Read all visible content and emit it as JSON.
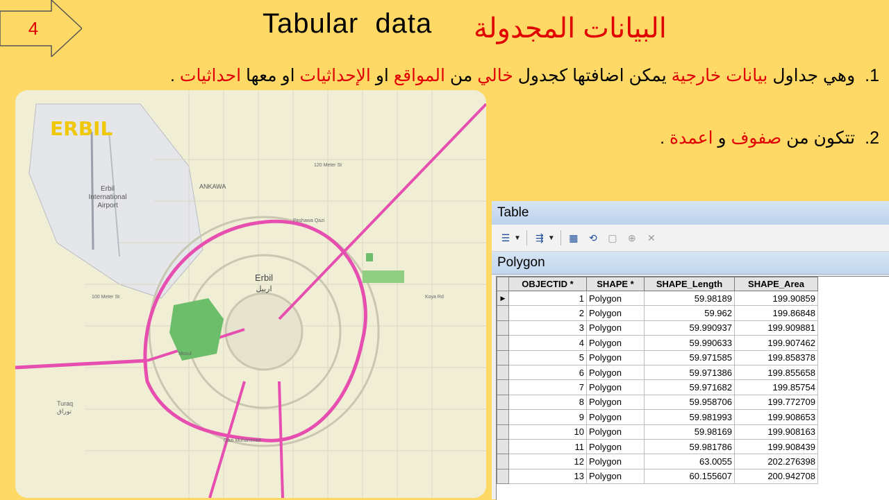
{
  "slide_number": "4",
  "title_en": "Tabular  data",
  "title_ar": "البيانات المجدولة",
  "bullets": [
    {
      "num": "1.",
      "parts": [
        {
          "t": "وهي جداول ",
          "red": false
        },
        {
          "t": "بيانات خارجية",
          "red": true
        },
        {
          "t": " يمكن اضافتها كجدول ",
          "red": false
        },
        {
          "t": "خالي",
          "red": true
        },
        {
          "t": " من ",
          "red": false
        },
        {
          "t": "المواقع",
          "red": true
        },
        {
          "t": " او ",
          "red": false
        },
        {
          "t": "الإحداثيات",
          "red": true
        },
        {
          "t": " او معها ",
          "red": false
        },
        {
          "t": "احداثيات",
          "red": true
        },
        {
          "t": " .",
          "red": false
        }
      ]
    },
    {
      "num": "2.",
      "parts": [
        {
          "t": "تتكون من ",
          "red": false
        },
        {
          "t": "صفوف",
          "red": true
        },
        {
          "t": " و ",
          "red": false
        },
        {
          "t": "اعمدة",
          "red": true
        },
        {
          "t": " .",
          "red": false
        }
      ]
    }
  ],
  "map": {
    "logo": "ERBIL",
    "city_en": "Erbil",
    "city_ar": "اربيل",
    "airport": [
      "Erbil",
      "International",
      "Airport"
    ],
    "district_ankawa": "ANKAWA",
    "turaq_en": "Turaq",
    "turaq_ar": "توراق",
    "road_labels": [
      "Peshawa Qazi",
      "120 Meter St",
      "Koya Rd",
      "Mosul",
      "Qazi Muhammad",
      "100 Meter St"
    ]
  },
  "table": {
    "window_title": "Table",
    "layer_name": "Polygon",
    "columns": [
      "OBJECTID *",
      "SHAPE *",
      "SHAPE_Length",
      "SHAPE_Area"
    ],
    "rows": [
      [
        "1",
        "Polygon",
        "59.98189",
        "199.90859"
      ],
      [
        "2",
        "Polygon",
        "59.962",
        "199.86848"
      ],
      [
        "3",
        "Polygon",
        "59.990937",
        "199.909881"
      ],
      [
        "4",
        "Polygon",
        "59.990633",
        "199.907462"
      ],
      [
        "5",
        "Polygon",
        "59.971585",
        "199.858378"
      ],
      [
        "6",
        "Polygon",
        "59.971386",
        "199.855658"
      ],
      [
        "7",
        "Polygon",
        "59.971682",
        "199.85754"
      ],
      [
        "8",
        "Polygon",
        "59.958706",
        "199.772709"
      ],
      [
        "9",
        "Polygon",
        "59.981993",
        "199.908653"
      ],
      [
        "10",
        "Polygon",
        "59.98169",
        "199.908163"
      ],
      [
        "11",
        "Polygon",
        "59.981786",
        "199.908439"
      ],
      [
        "12",
        "Polygon",
        "63.0055",
        "202.276398"
      ],
      [
        "13",
        "Polygon",
        "60.155607",
        "200.942708"
      ]
    ]
  },
  "colors": {
    "background": "#FFD966",
    "accent_red": "#e00000",
    "road_pink": "#E64FB0",
    "park_green": "#6DBE6A"
  }
}
